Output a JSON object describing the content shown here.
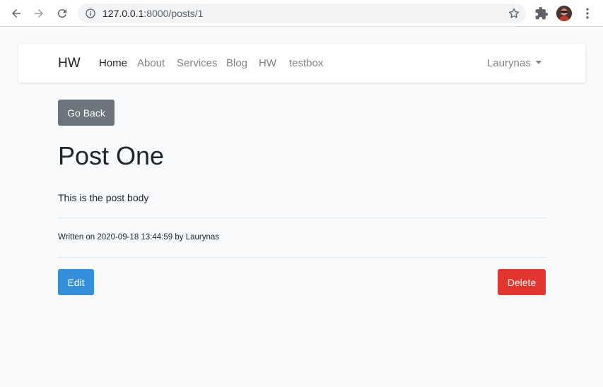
{
  "browser": {
    "url_host": "127.0.0.1",
    "url_rest": ":8000/posts/1"
  },
  "navbar": {
    "brand": "HW",
    "links": [
      "Home",
      "About",
      "Services",
      "Blog",
      "HW",
      "testbox"
    ],
    "active_link": "Home",
    "user": "Laurynas"
  },
  "post": {
    "back_label": "Go Back",
    "title": "Post One",
    "body": "This is the post body",
    "meta": "Written on 2020-09-18 13:44:59 by Laurynas",
    "edit_label": "Edit",
    "delete_label": "Delete"
  },
  "colors": {
    "back_button": "#6c757d",
    "edit_button": "#3490dc",
    "delete_button": "#e3342f",
    "page_background": "#f8fafc"
  }
}
